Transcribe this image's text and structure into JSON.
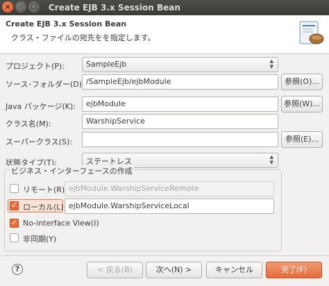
{
  "window": {
    "title": "Create EJB 3.x Session Bean",
    "close_glyph": "×",
    "min_glyph": "–",
    "max_glyph": "□"
  },
  "header": {
    "title": "Create EJB 3.x Session Bean",
    "description": "クラス・ファイルの宛先をを指定します。",
    "banner_icon": "wizard-banner-icon"
  },
  "form": {
    "project_label": "プロジェクト(P):",
    "project_value": "SampleEjb",
    "source_folder_label": "ソース･フォルダー(D):",
    "source_folder_value": "/SampleEjb/ejbModule",
    "browse_label_o": "参照(O)...",
    "package_label": "Java パッケージ(K):",
    "package_value": "ejbModule",
    "browse_label_w": "参照(W)...",
    "class_label": "クラス名(M):",
    "class_value": "WarshipService",
    "superclass_label": "スーパークラス(S):",
    "superclass_value": "",
    "browse_label_e": "参照(E)...",
    "state_type_label": "状態タイプ(T):",
    "state_type_value": "ステートレス"
  },
  "interfaces": {
    "group_title": "ビジネス・インターフェースの作成",
    "remote_label": "リモート(R)",
    "remote_checked": false,
    "remote_value": "ejbModule.WarshipServiceRemote",
    "local_label": "ローカル(L)",
    "local_checked": true,
    "local_value": "ejbModule.WarshipServiceLocal",
    "no_interface_label": "No-interface View(I)",
    "no_interface_checked": true,
    "async_label": "非同期(Y)",
    "async_checked": false
  },
  "footer": {
    "help_glyph": "?",
    "back_label": "< 戻る(B)",
    "next_label": "次へ(N) >",
    "cancel_label": "キャンセル",
    "finish_label": "完了(F)"
  },
  "colors": {
    "accent": "#e56b3b",
    "titlebar": "#3c3b37",
    "background": "#f2f1f0"
  }
}
